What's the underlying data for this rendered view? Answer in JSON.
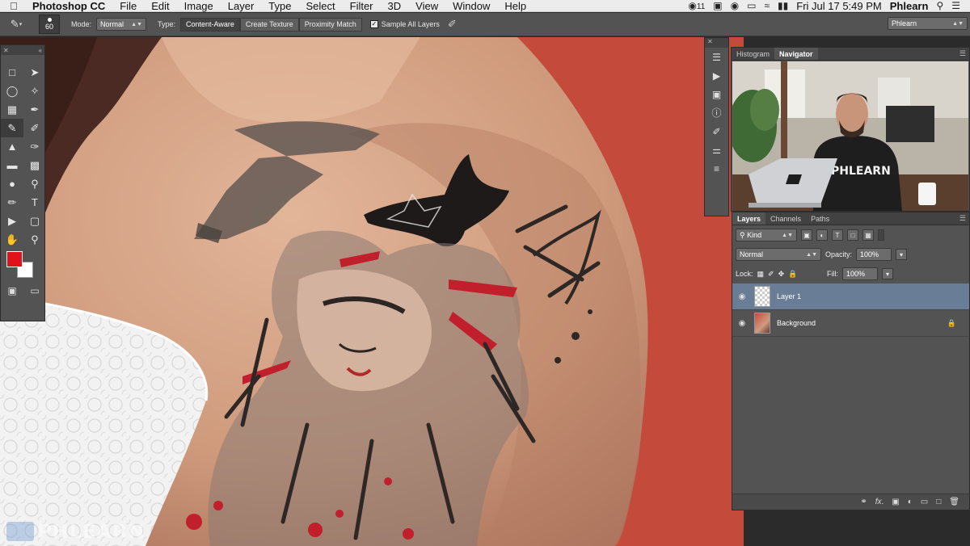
{
  "menubar": {
    "app_name": "Photoshop CC",
    "items": [
      "File",
      "Edit",
      "Image",
      "Layer",
      "Type",
      "Select",
      "Filter",
      "3D",
      "View",
      "Window",
      "Help"
    ],
    "right": {
      "cc_count": "11",
      "datetime": "Fri Jul 17  5:49 PM",
      "user": "Phlearn"
    }
  },
  "options_bar": {
    "brush_size": "60",
    "mode_label": "Mode:",
    "mode_value": "Normal",
    "type_label": "Type:",
    "type_options": [
      {
        "label": "Content-Aware",
        "active": true
      },
      {
        "label": "Create Texture",
        "active": false
      },
      {
        "label": "Proximity Match",
        "active": false
      }
    ],
    "sample_all_layers": {
      "label": "Sample All Layers",
      "checked": true
    },
    "workspace": "Phlearn"
  },
  "navigator_panel": {
    "tabs": [
      {
        "label": "Histogram",
        "active": false
      },
      {
        "label": "Navigator",
        "active": true
      }
    ]
  },
  "layers_panel": {
    "tabs": [
      {
        "label": "Layers",
        "active": true
      },
      {
        "label": "Channels",
        "active": false
      },
      {
        "label": "Paths",
        "active": false
      }
    ],
    "filter_kind": "Kind",
    "blend_mode": "Normal",
    "opacity_label": "Opacity:",
    "opacity": "100%",
    "lock_label": "Lock:",
    "fill_label": "Fill:",
    "fill": "100%",
    "layers": [
      {
        "name": "Layer 1",
        "selected": true,
        "locked": false,
        "visible": true
      },
      {
        "name": "Background",
        "selected": false,
        "locked": true,
        "visible": true
      }
    ]
  },
  "tools": {
    "foreground_color": "#e0131a",
    "background_color": "#ffffff"
  },
  "watermark": "PHLEARN",
  "colors": {
    "panel": "#535353",
    "canvas_bg": "#c44a3c",
    "selection": "#6a7d96"
  }
}
